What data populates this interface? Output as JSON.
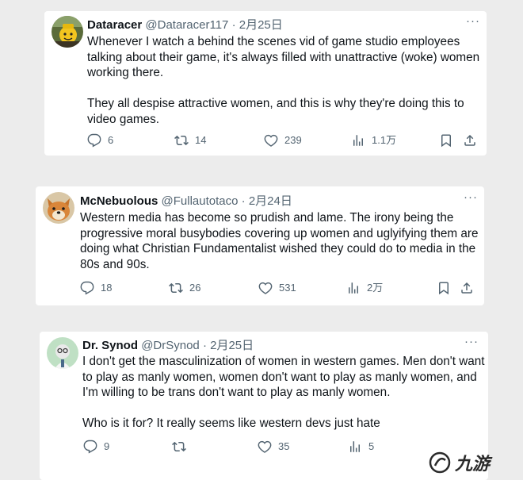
{
  "tweets": [
    {
      "display_name": "Dataracer",
      "handle": "@Dataracer117",
      "dot": "·",
      "date": "2月25日",
      "more": "···",
      "body_lines": [
        "Whenever I watch a behind the scenes vid of game studio employees",
        "talking about their game, it's always filled with unattractive (woke) women",
        "working there.",
        "",
        "They all despise attractive women, and this is why they're doing this to",
        "video games."
      ],
      "replies": "6",
      "retweets": "14",
      "likes": "239",
      "views": "1.1万",
      "avatar_icon": "yellow-lego-avatar"
    },
    {
      "display_name": "McNebuolous",
      "handle": "@Fullautotaco",
      "dot": "·",
      "date": "2月24日",
      "more": "···",
      "body_lines": [
        "Western media has become so prudish and lame.  The irony being the",
        "progressive moral busybodies covering up women and uglyifying them are",
        "doing what Christian Fundamentalist wished they could do to media in the",
        "80s and 90s."
      ],
      "replies": "18",
      "retweets": "26",
      "likes": "531",
      "views": "2万",
      "avatar_icon": "shiba-dog-avatar"
    },
    {
      "display_name": "Dr. Synod",
      "handle": "@DrSynod",
      "dot": "·",
      "date": "2月25日",
      "more": "···",
      "body_lines": [
        "I don't get the masculinization of women in western games. Men don't want",
        "to play as manly women, women don't want to play as manly women, and",
        "I'm willing to be trans don't want to play as manly women.",
        "",
        "Who is it for? It really seems like western devs just hate"
      ],
      "replies": "9",
      "retweets": "",
      "likes": "35",
      "views": "5",
      "avatar_icon": "cartoon-doctor-avatar"
    }
  ],
  "watermark": {
    "text": "九游",
    "icon": "nine-game-logo"
  },
  "colors": {
    "background": "#ececec",
    "card": "#ffffff",
    "text": "#0f1419",
    "muted": "#536471"
  }
}
